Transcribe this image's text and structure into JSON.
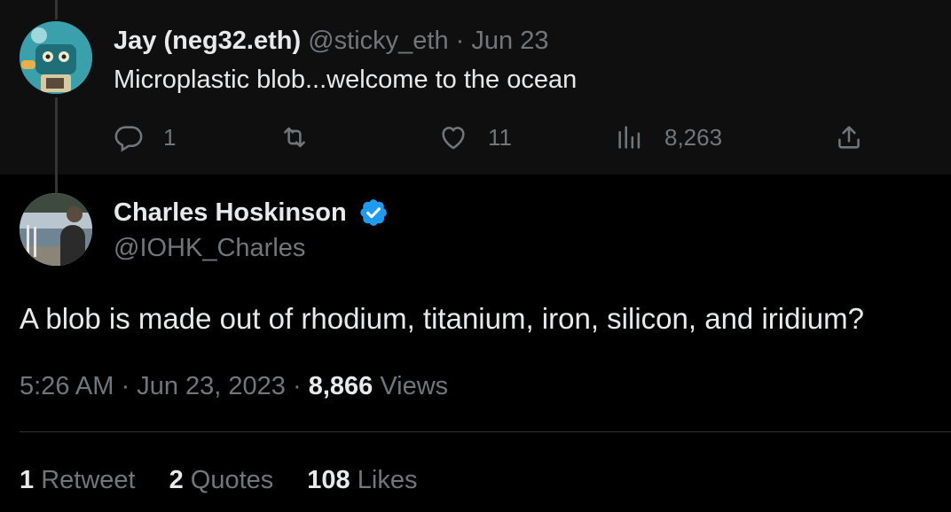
{
  "reply": {
    "name": "Jay (neg32.eth)",
    "handle": "@sticky_eth",
    "separator": "·",
    "date": "Jun 23",
    "text": "Microplastic blob...welcome to the ocean",
    "actions": {
      "replies": "1",
      "retweets": "",
      "likes": "11",
      "views": "8,263"
    }
  },
  "tweet": {
    "name": "Charles Hoskinson",
    "handle": "@IOHK_Charles",
    "text": "A blob is made out of rhodium, titanium, iron, silicon, and iridium?",
    "time": "5:26 AM",
    "sep1": "·",
    "date": "Jun 23, 2023",
    "sep2": "·",
    "views_count": "8,866",
    "views_label": "Views",
    "stats": {
      "retweets_count": "1",
      "retweets_label": "Retweet",
      "quotes_count": "2",
      "quotes_label": "Quotes",
      "likes_count": "108",
      "likes_label": "Likes"
    }
  },
  "colors": {
    "background": "#000000",
    "reply_background": "#0f0f10",
    "text": "#e7e9ea",
    "muted": "#71767b",
    "verified": "#1d9bf0"
  }
}
